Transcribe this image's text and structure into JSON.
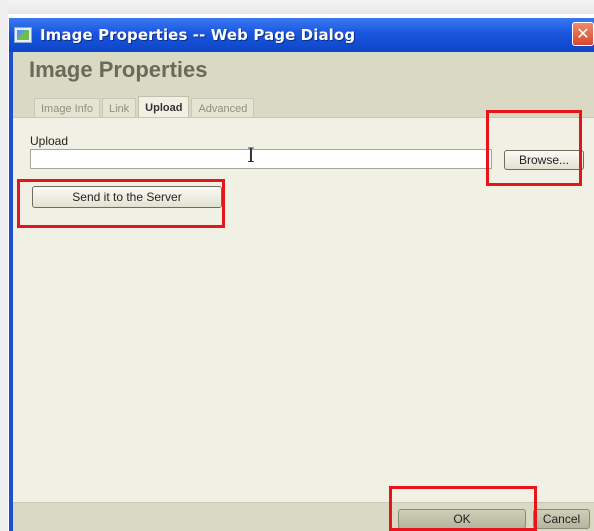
{
  "dialog": {
    "window_title": "Image Properties -- Web Page Dialog",
    "close_symbol": "✕",
    "heading": "Image Properties"
  },
  "tabs": [
    {
      "label": "Image Info",
      "active": false
    },
    {
      "label": "Link",
      "active": false
    },
    {
      "label": "Upload",
      "active": true
    },
    {
      "label": "Advanced",
      "active": false
    }
  ],
  "upload": {
    "label": "Upload",
    "value": "",
    "browse_label": "Browse...",
    "send_label": "Send it to the Server"
  },
  "footer": {
    "ok_label": "OK",
    "cancel_label": "Cancel"
  },
  "icons": {
    "title_icon": "dialog-image-icon",
    "close_icon": "close-icon"
  },
  "colors": {
    "titlebar": "#1a56de",
    "highlight": "#e8141c",
    "panel": "#f1f0e4"
  }
}
